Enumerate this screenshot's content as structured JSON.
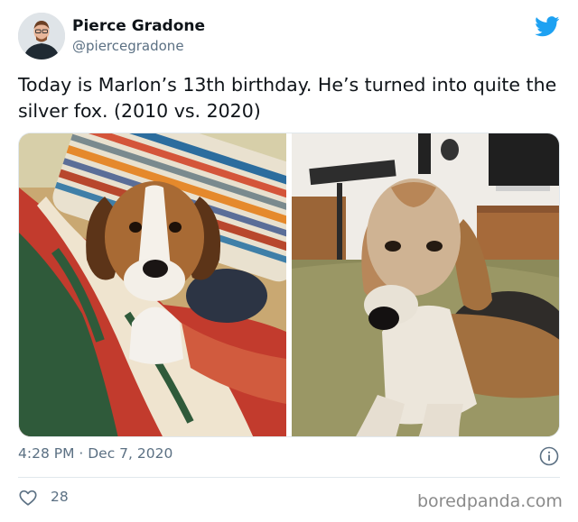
{
  "author": {
    "display_name": "Pierce Gradone",
    "handle": "@piercegradone",
    "avatar_icon": "avatar-photo"
  },
  "tweet": {
    "text": "Today is Marlon’s 13th birthday. He’s turned into quite the silver fox. (2010 vs. 2020)",
    "timestamp": "4:28 PM · Dec 7, 2020",
    "like_count": "28"
  },
  "media": {
    "photos": [
      {
        "icon": "puppy-photo"
      },
      {
        "icon": "senior-dog-photo"
      }
    ]
  },
  "icons": {
    "brand": "twitter-bird-icon",
    "info": "info-icon",
    "like": "heart-icon"
  },
  "watermark": "boredpanda.com",
  "colors": {
    "twitter_blue": "#1da1f2",
    "secondary_text": "#5b7083",
    "divider": "#e1e8ed"
  }
}
